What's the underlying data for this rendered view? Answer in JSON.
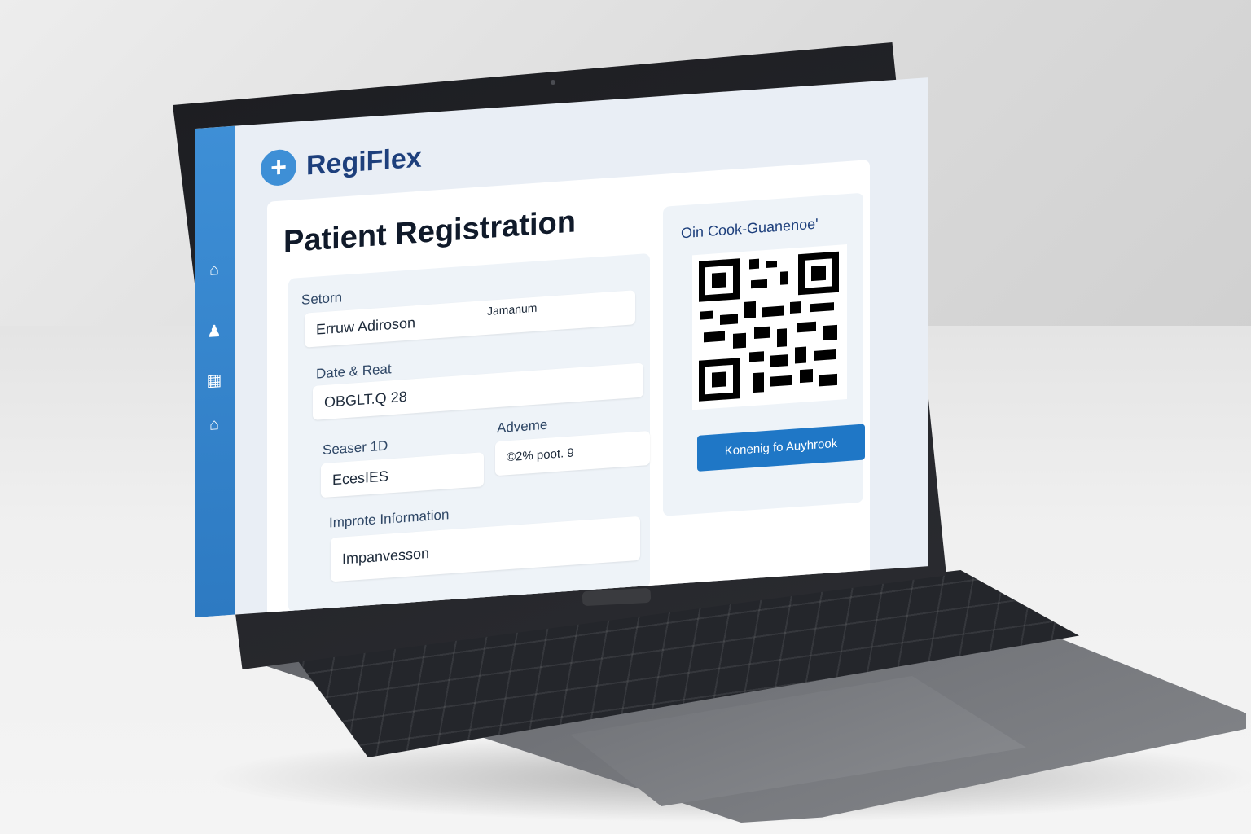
{
  "app": {
    "brand_name": "RegiFlex"
  },
  "sidebar": {
    "icons": [
      "home-icon",
      "user-icon",
      "grid-icon",
      "building-icon"
    ]
  },
  "page": {
    "title": "Patient Registration"
  },
  "form": {
    "section_label": "Setorn",
    "name_value": "Erruw Adiroson",
    "name_secondary": "Jamanum",
    "date_label": "Date & Reat",
    "date_value": "OBGLT.Q 28",
    "id_label": "Seaser 1D",
    "id_value": "EcesIES",
    "address_label": "Adveme",
    "address_value": "©2% poot. 9",
    "info_label": "Improte Information",
    "info_value": "Impanvesson"
  },
  "qr": {
    "heading": "Oin Cook-Guanenoe'",
    "button_label": "Konenig fo Auyhrook"
  },
  "colors": {
    "sidebar": "#3e8fd6",
    "brand_text": "#1d3f7c",
    "button": "#1f77c6"
  }
}
